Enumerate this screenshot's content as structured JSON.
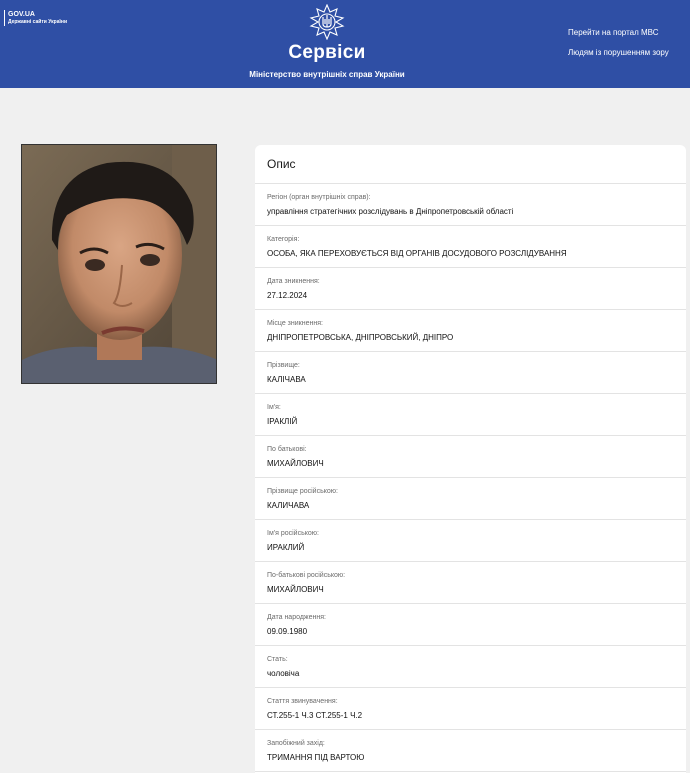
{
  "header": {
    "gov_title": "GOV.UA",
    "gov_subtitle": "Державні сайти України",
    "site_title": "Сервіси",
    "site_subtitle": "Міністерство внутрішніх справ України",
    "links": {
      "portal": "Перейти на портал МВС",
      "vision": "Людям із порушенням зору"
    },
    "emblem_icon": "trident-star-emblem-icon",
    "background_color": "#2f4fa5"
  },
  "photo": {
    "icon": "person-photo"
  },
  "card": {
    "title": "Опис",
    "fields": [
      {
        "label": "Регіон (орган внутрішніх справ):",
        "value": "управління стратегічних розслідувань в Дніпропетровській області"
      },
      {
        "label": "Категорія:",
        "value": "ОСОБА, ЯКА ПЕРЕХОВУЄТЬСЯ ВІД ОРГАНІВ ДОСУДОВОГО РОЗСЛІДУВАННЯ"
      },
      {
        "label": "Дата зникнення:",
        "value": "27.12.2024"
      },
      {
        "label": "Місце зникнення:",
        "value": "ДНІПРОПЕТРОВСЬКА, ДНІПРОВСЬКИЙ, ДНІПРО"
      },
      {
        "label": "Прізвище:",
        "value": "КАЛІЧАВА"
      },
      {
        "label": "Ім'я:",
        "value": "ІРАКЛІЙ"
      },
      {
        "label": "По батькові:",
        "value": "МИХАЙЛОВИЧ"
      },
      {
        "label": "Прізвище російською:",
        "value": "КАЛИЧАВА"
      },
      {
        "label": "Ім'я російською:",
        "value": "ИРАКЛИЙ"
      },
      {
        "label": "По-батькові російською:",
        "value": "МИХАЙЛОВИЧ"
      },
      {
        "label": "Дата народження:",
        "value": "09.09.1980"
      },
      {
        "label": "Стать:",
        "value": "чоловіча"
      },
      {
        "label": "Стаття звинувачення:",
        "value": "СТ.255-1 Ч.3 СТ.255-1 Ч.2"
      },
      {
        "label": "Запобіжний захід:",
        "value": "ТРИМАННЯ ПІД ВАРТОЮ"
      }
    ]
  }
}
